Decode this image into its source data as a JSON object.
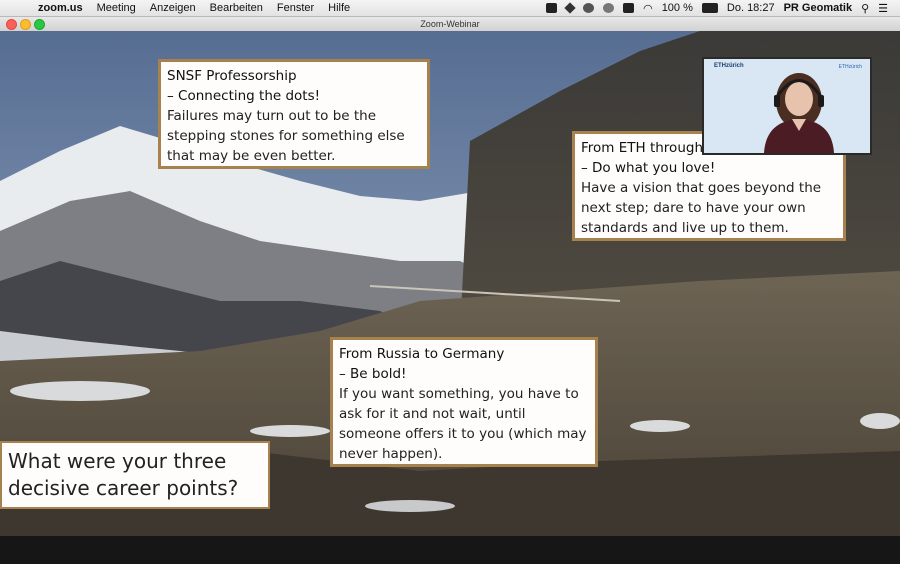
{
  "menubar": {
    "app_name": "zoom.us",
    "items": [
      "Meeting",
      "Anzeigen",
      "Bearbeiten",
      "Fenster",
      "Hilfe"
    ],
    "battery": "100 %",
    "datetime": "Do. 18:27",
    "user": "PR Geomatik"
  },
  "window": {
    "title": "Zoom-Webinar"
  },
  "slide": {
    "card_snsf": {
      "title_line1": "SNSF Professorship",
      "title_line2": "– Connecting the dots!",
      "body": "Failures may turn out to be the stepping stones for something else that may be even better."
    },
    "card_eth": {
      "title_line1": "From ETH through",
      "title_line2": "– Do what you love!",
      "body": "Have a vision that goes beyond the next step; dare to have your own standards and live up to them."
    },
    "card_russia": {
      "title_line1": "From Russia to Germany",
      "title_line2": "– Be bold!",
      "body": "If you want something, you have to ask for it and not wait, until someone offers it to you (which may never happen)."
    },
    "question": "What were your three decisive career points?"
  },
  "video": {
    "logo_left": "ETHzürich",
    "logo_right": "ETHzürich"
  },
  "colors": {
    "card_border": "#a7824f",
    "sky": "#6f86a8"
  }
}
